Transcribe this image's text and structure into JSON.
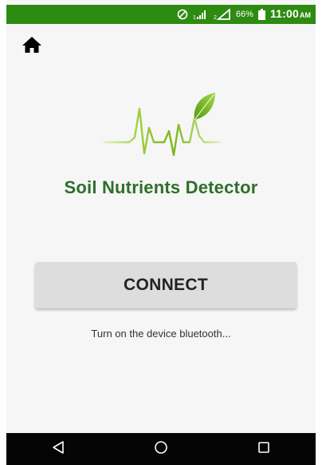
{
  "status_bar": {
    "battery_percent": "66%",
    "time": "11:00",
    "am_pm": "AM",
    "color": "#2e8b12",
    "icons": [
      "do-not-disturb-icon",
      "signal-sim1-icon",
      "signal-sim2-icon",
      "battery-icon"
    ]
  },
  "toolbar": {
    "home_icon": "home-icon"
  },
  "app": {
    "title": "Soil Nutrients Detector",
    "title_color": "#2f6e2c",
    "logo_icon": "heartbeat-leaf-logo"
  },
  "main": {
    "connect_label": "CONNECT",
    "status_text": "Turn on the device bluetooth..."
  },
  "nav": {
    "icons": [
      "back-icon",
      "home-circle-icon",
      "recents-icon"
    ]
  }
}
